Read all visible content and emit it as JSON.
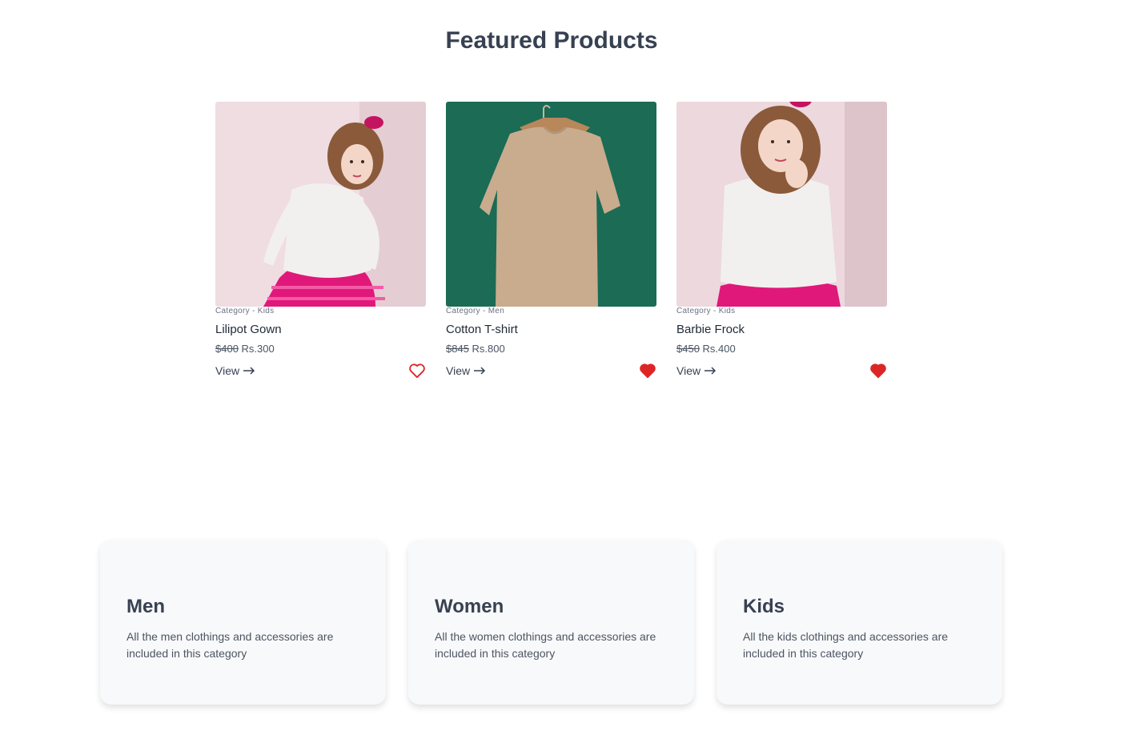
{
  "section_title": "Featured Products",
  "products": [
    {
      "category": "Category - Kids",
      "name": "Lilipot Gown",
      "old_price": "$400",
      "price": "Rs.300",
      "view_label": "View",
      "favorite": false
    },
    {
      "category": "Category - Men",
      "name": "Cotton T-shirt",
      "old_price": "$845",
      "price": "Rs.800",
      "view_label": "View",
      "favorite": true
    },
    {
      "category": "Category - Kids",
      "name": "Barbie Frock",
      "old_price": "$450",
      "price": "Rs.400",
      "view_label": "View",
      "favorite": true
    }
  ],
  "categories": [
    {
      "title": "Men",
      "description": "All the men clothings and accessories are included in this category"
    },
    {
      "title": "Women",
      "description": "All the women clothings and accessories are included in this category"
    },
    {
      "title": "Kids",
      "description": "All the kids clothings and accessories are included in this category"
    }
  ],
  "colors": {
    "heart": "#dc2626",
    "tshirt_bg": "#1b6b55",
    "kids_bg": "#efdde2",
    "dress": "#e0187a"
  },
  "icons": {
    "view_arrow": "arrow-right-icon",
    "favorite": "heart-icon"
  }
}
